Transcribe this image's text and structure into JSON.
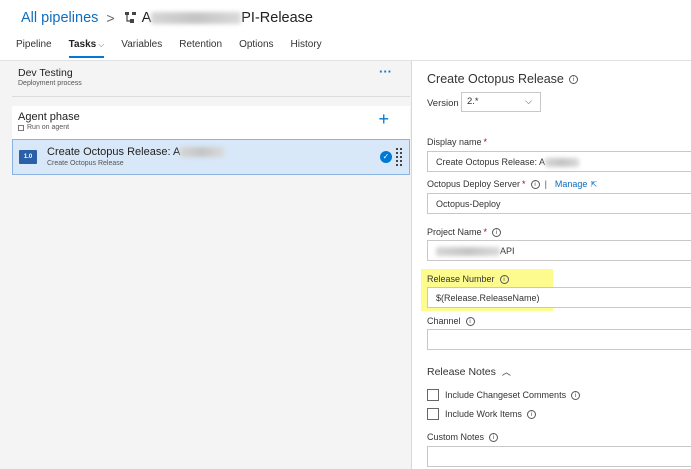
{
  "breadcrumb": {
    "all_pipelines": "All pipelines",
    "separator": ">",
    "title_prefix": "A",
    "title_suffix": "PI-Release"
  },
  "tabs": [
    {
      "label": "Pipeline",
      "active": false
    },
    {
      "label": "Tasks",
      "active": true
    },
    {
      "label": "Variables",
      "active": false
    },
    {
      "label": "Retention",
      "active": false
    },
    {
      "label": "Options",
      "active": false
    },
    {
      "label": "History",
      "active": false
    }
  ],
  "stage": {
    "name": "Dev Testing",
    "subtitle": "Deployment process",
    "more": "···"
  },
  "phase": {
    "name": "Agent phase",
    "subtitle": "Run on agent",
    "add": "+"
  },
  "task": {
    "badge": "1.0",
    "name": "Create Octopus Release: A",
    "subtitle": "Create Octopus Release",
    "check": "✓"
  },
  "detail": {
    "title": "Create Octopus Release",
    "version_label": "Version",
    "version_value": "2.*",
    "display_name_label": "Display name",
    "display_name_value": "Create Octopus Release: A",
    "server_label": "Octopus Deploy Server",
    "manage_link": "Manage",
    "server_value": "Octopus-Deploy",
    "project_label": "Project Name",
    "project_value_suffix": "API",
    "release_number_label": "Release Number",
    "release_number_value": "$(Release.ReleaseName)",
    "channel_label": "Channel",
    "channel_value": "",
    "release_notes_label": "Release Notes",
    "include_changeset": "Include Changeset Comments",
    "include_work_items": "Include Work Items",
    "custom_notes_label": "Custom Notes",
    "custom_notes_value": "",
    "required_mark": "*",
    "info_glyph": "i"
  },
  "colors": {
    "accent": "#0078d4",
    "highlight": "#fdfb8e",
    "selected_row": "#d8e8f8"
  }
}
